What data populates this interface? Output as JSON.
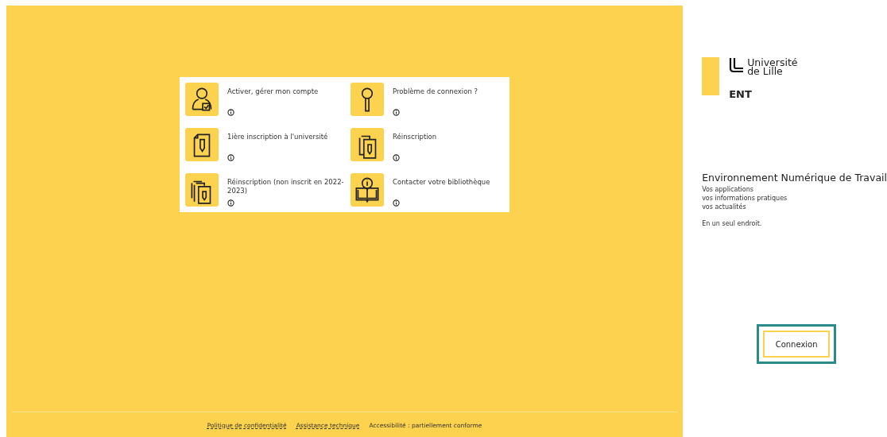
{
  "services": [
    {
      "label": "Activer, gérer mon compte",
      "kind": "person"
    },
    {
      "label": "Problème de connexion ?",
      "kind": "key"
    },
    {
      "label": "1ière inscription à l'université",
      "kind": "document"
    },
    {
      "label": "Réinscription",
      "kind": "documents"
    },
    {
      "label": "Réinscription (non inscrit en 2022-2023)",
      "kind": "stack"
    },
    {
      "label": "Contacter votre bibliothèque",
      "kind": "book"
    }
  ],
  "footer_links": [
    {
      "label": "Politique de confidentialité",
      "kind": "link"
    },
    {
      "label": "Assistance technique",
      "kind": "link"
    },
    {
      "label": "Accessibilité : partiellement conforme",
      "kind": "text"
    }
  ],
  "sidebar": {
    "logo_lines": [
      "Université",
      "de Lille"
    ],
    "app": "ENT",
    "title": "Environnement Numérique de Travail",
    "lines": [
      "Vos applications",
      "vos informations pratiques",
      "vos actualités"
    ],
    "tagline": "En un seul endroit.",
    "button": "Connexion"
  }
}
